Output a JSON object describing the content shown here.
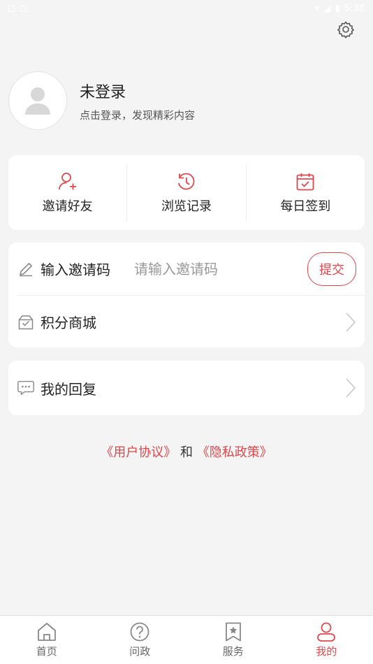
{
  "status_bar": {
    "time": "5:38"
  },
  "header": {
    "settings_icon": "gear-icon"
  },
  "profile": {
    "name": "未登录",
    "subtitle": "点击登录，发现精彩内容",
    "avatar_icon": "person-icon"
  },
  "quick_actions": [
    {
      "label": "邀请好友",
      "icon": "add-user-icon"
    },
    {
      "label": "浏览记录",
      "icon": "history-icon"
    },
    {
      "label": "每日签到",
      "icon": "calendar-check-icon"
    }
  ],
  "invite": {
    "label": "输入邀请码",
    "placeholder": "请输入邀请码",
    "value": "",
    "submit_label": "提交",
    "icon": "pencil-icon"
  },
  "menu": {
    "points_mall": {
      "label": "积分商城",
      "icon": "gift-box-icon"
    },
    "my_replies": {
      "label": "我的回复",
      "icon": "chat-bubble-icon"
    }
  },
  "agreement": {
    "user_agreement": "《用户协议》",
    "and": "和",
    "privacy_policy": "《隐私政策》"
  },
  "tabbar": [
    {
      "label": "首页",
      "icon": "home-icon",
      "active": false
    },
    {
      "label": "问政",
      "icon": "question-icon",
      "active": false
    },
    {
      "label": "服务",
      "icon": "bookmark-star-icon",
      "active": false
    },
    {
      "label": "我的",
      "icon": "user-icon",
      "active": true
    }
  ],
  "colors": {
    "accent": "#e0474c",
    "background": "#f4f4f4",
    "card": "#ffffff"
  }
}
